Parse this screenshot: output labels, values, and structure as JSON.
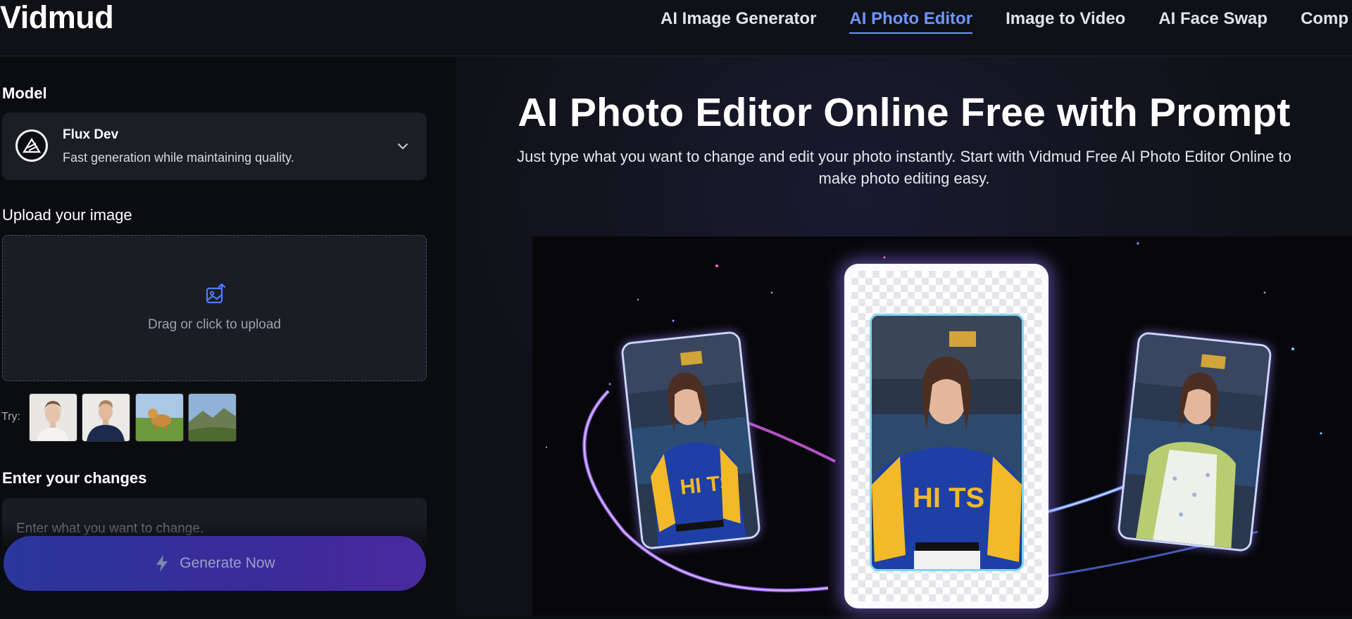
{
  "header": {
    "logo": "Vidmud",
    "nav": [
      {
        "label": "AI Image Generator",
        "active": false
      },
      {
        "label": "AI Photo Editor",
        "active": true
      },
      {
        "label": "Image to Video",
        "active": false
      },
      {
        "label": "AI Face Swap",
        "active": false
      },
      {
        "label": "Comp",
        "active": false
      }
    ]
  },
  "sidebar": {
    "model_label": "Model",
    "model": {
      "name": "Flux Dev",
      "description": "Fast generation while maintaining quality."
    },
    "upload_label": "Upload your image",
    "upload_text": "Drag or click to upload",
    "try_label": "Try:",
    "try_samples": [
      "woman-portrait",
      "man-portrait",
      "dog-in-field",
      "landscape-hills"
    ],
    "changes_label": "Enter your changes",
    "changes_placeholder": "Enter what you want to change.",
    "generate_label": "Generate Now"
  },
  "hero": {
    "title": "AI Photo Editor Online Free with Prompt",
    "subtitle_line1": "Just type what you want to change and edit your photo instantly. Start with Vidmud Free AI Photo Editor Online to",
    "subtitle_line2": "make photo editing easy."
  },
  "colors": {
    "accent": "#6d96ff",
    "background": "#0d0e12",
    "button_gradient_start": "#2a379c",
    "button_gradient_end": "#4a2aa0",
    "glow": "#a77bff"
  }
}
